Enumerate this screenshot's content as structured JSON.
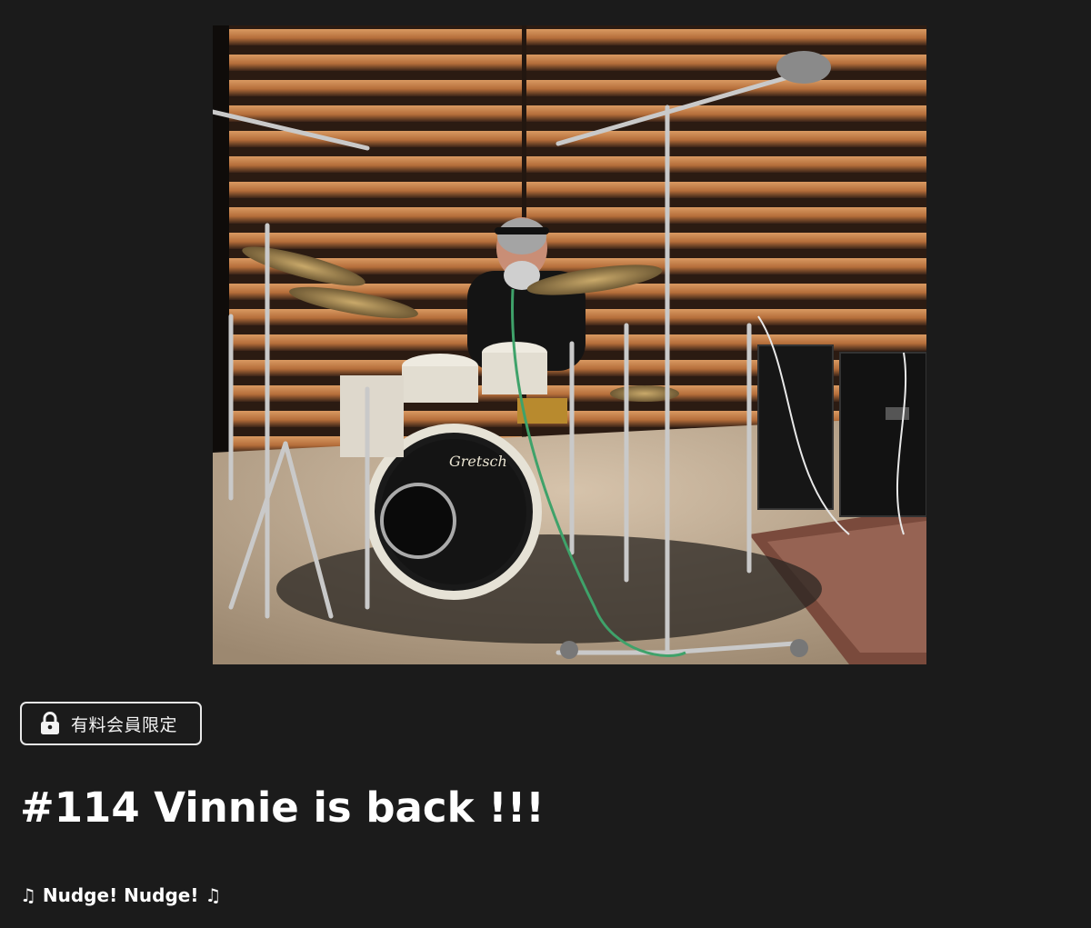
{
  "video": {
    "thumbnail_icon": "drummer-studio-photo",
    "drum_brand_text": "Gretsch"
  },
  "badge": {
    "icon": "lock-icon",
    "label": "有料会員限定"
  },
  "post": {
    "title": "#114 Vinnie is back !!!",
    "subtitle": "♫ Nudge! Nudge! ♫"
  },
  "colors": {
    "background": "#1b1b1b",
    "text": "#ffffff",
    "badge_border": "#e8e8e8"
  }
}
